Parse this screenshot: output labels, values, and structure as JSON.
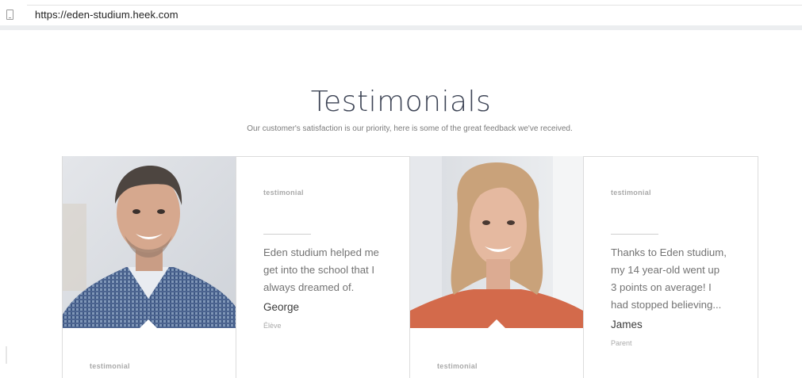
{
  "browser": {
    "url": "https://eden-studium.heek.com"
  },
  "section": {
    "title": "Testimonials",
    "subtitle": "Our customer's satisfaction is our priority, here is some of the great feedback we've received."
  },
  "testimonials": [
    {
      "tag": "testimonial",
      "quote_lines": [
        "Eden studium helped me",
        "get into the school that I",
        "always dreamed of."
      ],
      "name": "George",
      "role": "Élève"
    },
    {
      "tag": "testimonial",
      "quote_lines": [
        "Thanks to Eden studium,",
        "my 14 year-old went up",
        "3 points on average! I",
        "had stopped believing..."
      ],
      "name": "James",
      "role": "Parent"
    },
    {
      "tag": "testimonial"
    },
    {
      "tag": "testimonial"
    }
  ],
  "icons": {
    "address_bar": "mobile-device-icon"
  },
  "colors": {
    "title": "#3d4455",
    "border": "#dcdcdc",
    "text": "#737373"
  }
}
